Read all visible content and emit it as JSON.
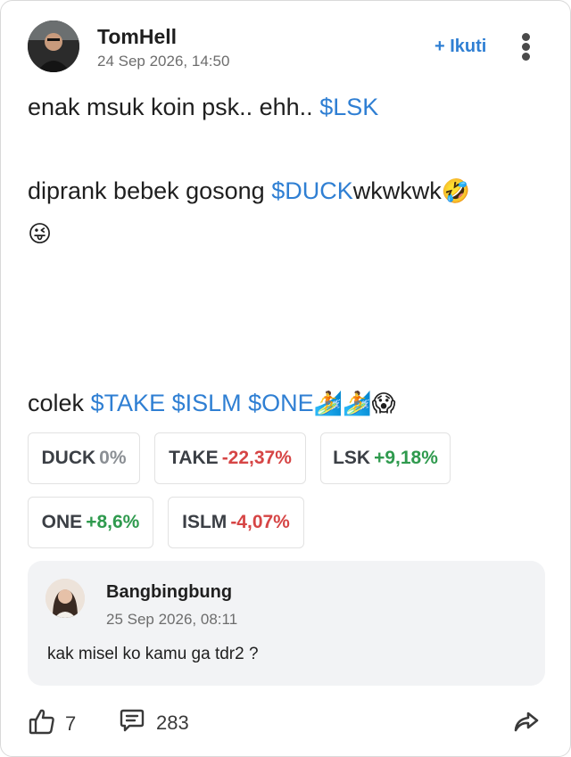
{
  "post": {
    "author": "TomHell",
    "timestamp": "24 Sep 2026, 14:50",
    "follow_label": "+ Ikuti",
    "line1_text": "enak msuk koin psk.. ehh..",
    "line1_tag": "$LSK",
    "line2_text": "diprank bebek gosong",
    "line2_tag": "$DUCK",
    "line2_suffix": "wkwkwk",
    "line2_emoji": "🤣",
    "line3_emoji": "😜",
    "line4_text": "colek",
    "line4_tags": [
      "$TAKE",
      "$ISLM",
      "$ONE"
    ],
    "line4_emojis": [
      "🏄",
      "🏄",
      "😱"
    ]
  },
  "tickers": [
    {
      "symbol": "DUCK",
      "change": "0%",
      "tone": "neutral"
    },
    {
      "symbol": "TAKE",
      "change": "-22,37%",
      "tone": "neg"
    },
    {
      "symbol": "LSK",
      "change": "+9,18%",
      "tone": "pos"
    },
    {
      "symbol": "ONE",
      "change": "+8,6%",
      "tone": "pos"
    },
    {
      "symbol": "ISLM",
      "change": "-4,07%",
      "tone": "neg"
    }
  ],
  "comment": {
    "author": "Bangbingbung",
    "timestamp": "25 Sep 2026, 08:11",
    "text": "kak misel ko kamu ga tdr2 ?"
  },
  "footer": {
    "likes": "7",
    "comments": "283"
  },
  "colors": {
    "accent": "#2f7fd3",
    "negative": "#d64545",
    "positive": "#2f9a4e",
    "neutral": "#8b8f94"
  }
}
